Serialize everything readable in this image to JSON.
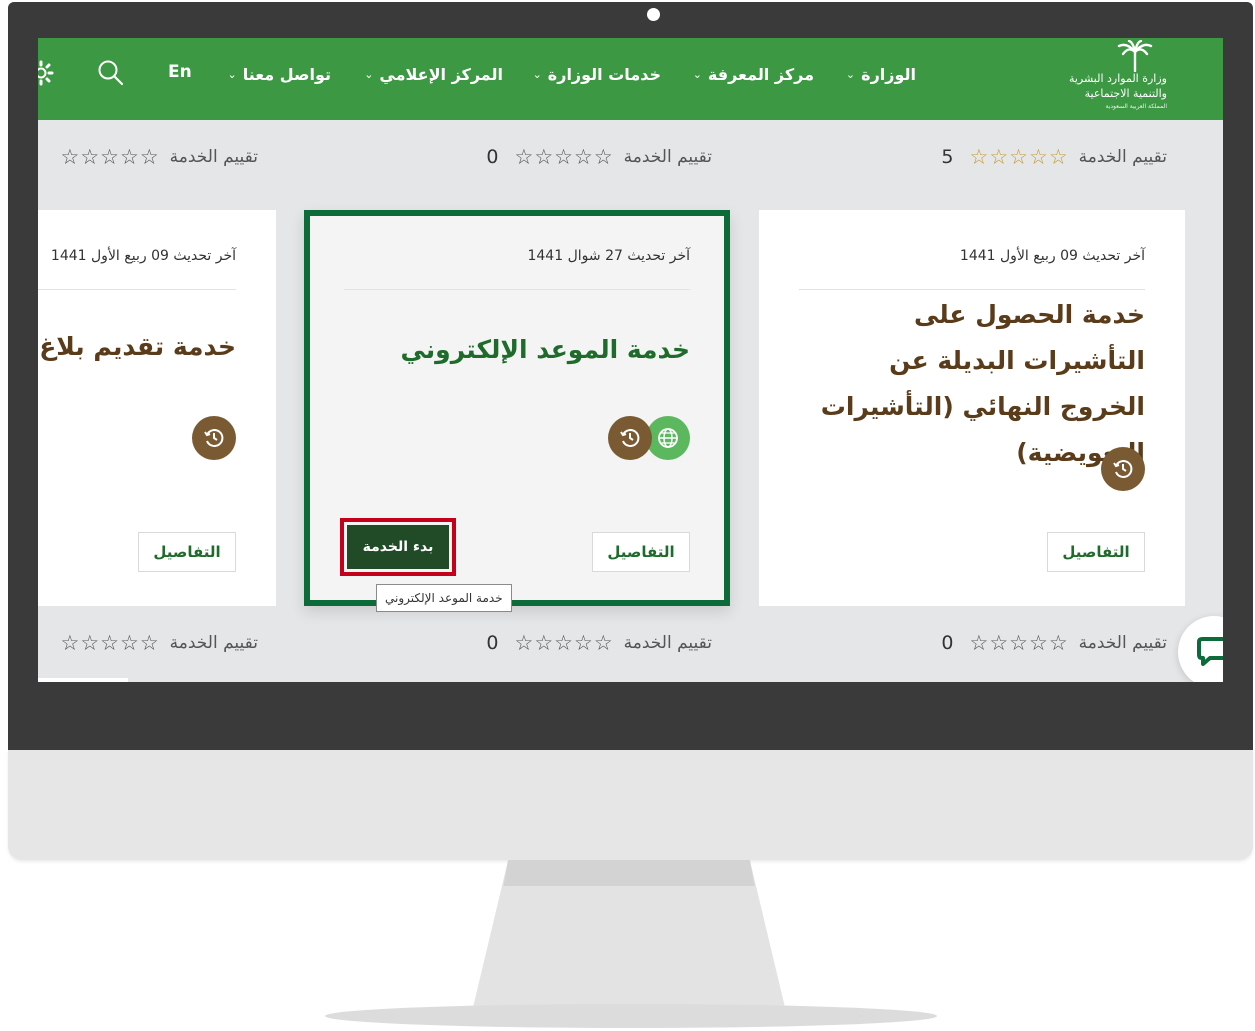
{
  "header": {
    "logo": {
      "line1": "وزارة الموارد البشرية",
      "line2": "والتنمية الاجتماعية",
      "line3": "المملكة العربية السعودية"
    },
    "nav": [
      {
        "label": "الوزارة"
      },
      {
        "label": "مركز المعرفة"
      },
      {
        "label": "خدمات الوزارة"
      },
      {
        "label": "المركز الإعلامي"
      },
      {
        "label": "تواصل معنا"
      }
    ],
    "lang_label": "En",
    "icons": {
      "search": "search-icon",
      "settings": "gear-icon",
      "dropdown": "chevron-down-icon"
    }
  },
  "ratings_top": [
    {
      "label": "تقييم الخدمة",
      "count": "5"
    },
    {
      "label": "تقييم الخدمة",
      "count": "0"
    },
    {
      "label": "تقييم الخدمة",
      "count": ""
    }
  ],
  "cards": [
    {
      "updated": "آخر تحديث 09 ربيع الأول 1441",
      "title": "خدمة الحصول على التأشيرات البديلة عن الخروج النهائي (التأشيرات التعويضية)",
      "details_label": "التفاصيل",
      "icons": [
        "clock-icon"
      ]
    },
    {
      "updated": "آخر تحديث 27 شوال 1441",
      "title": "خدمة الموعد الإلكتروني",
      "details_label": "التفاصيل",
      "start_label": "بدء الخدمة",
      "tooltip": "خدمة الموعد الإلكتروني",
      "icons": [
        "globe-icon",
        "clock-icon"
      ]
    },
    {
      "updated": "آخر تحديث 09 ربيع الأول 1441",
      "title": "خدمة تقديم بلاغ ت",
      "details_label": "التفاصيل",
      "icons": [
        "clock-icon"
      ]
    }
  ],
  "ratings_bottom": [
    {
      "label": "تقييم الخدمة",
      "count": "0"
    },
    {
      "label": "تقييم الخدمة",
      "count": "0"
    },
    {
      "label": "تقييم الخدمة",
      "count": ""
    }
  ],
  "stars": "☆☆☆☆☆",
  "chat": {
    "icon": "chat-icon"
  },
  "colors": {
    "nav_green": "#3d9843",
    "dark_green": "#0d6b3a",
    "start_button": "#214a26",
    "highlight_red": "#c4001a",
    "brown": "#7a5a33",
    "gold_star": "#c99a2e"
  }
}
